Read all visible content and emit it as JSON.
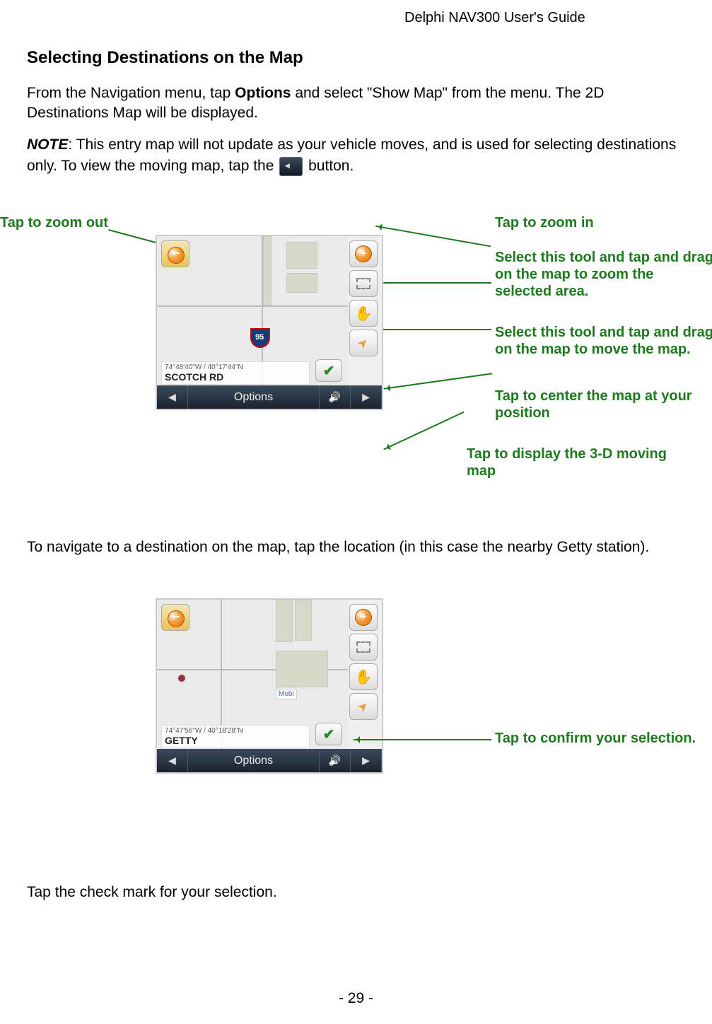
{
  "header": {
    "doc_title": "Delphi NAV300 User's Guide"
  },
  "section": {
    "heading": "Selecting Destinations on the Map"
  },
  "para1": {
    "pre": "From the Navigation menu, tap ",
    "bold": "Options",
    "post": " and select \"Show Map\" from the menu.  The 2D Destinations Map will be displayed."
  },
  "para2": {
    "note_label": "NOTE",
    "text_a": ": This entry map will not update as your vehicle moves, and is used for selecting destinations only.  To view the moving map, tap the ",
    "text_b": " button."
  },
  "callouts1": {
    "zoom_out": "Tap to zoom out",
    "zoom_in": "Tap to zoom in",
    "rect_tool": "Select this tool and tap and drag on the map to zoom the selected area.",
    "hand_tool": "Select this tool and tap and drag on the map to move the map.",
    "center": "Tap to center the map at your position",
    "three_d": "Tap to display the 3-D moving map"
  },
  "device1": {
    "coords": "74°48'40\"W / 40°17'44\"N",
    "road": "SCOTCH RD",
    "options_label": "Options",
    "shield": "95"
  },
  "para3": "To navigate to a destination on the map, tap the location (in this case the nearby Getty station).",
  "device2": {
    "coords": "74°47'56\"W / 40°18'28\"N",
    "road": "GETTY",
    "options_label": "Options",
    "poi": "Mobi"
  },
  "callouts2": {
    "confirm": "Tap to confirm your selection."
  },
  "para4": "Tap the check mark for your selection.",
  "footer": {
    "page": "- 29 -"
  }
}
